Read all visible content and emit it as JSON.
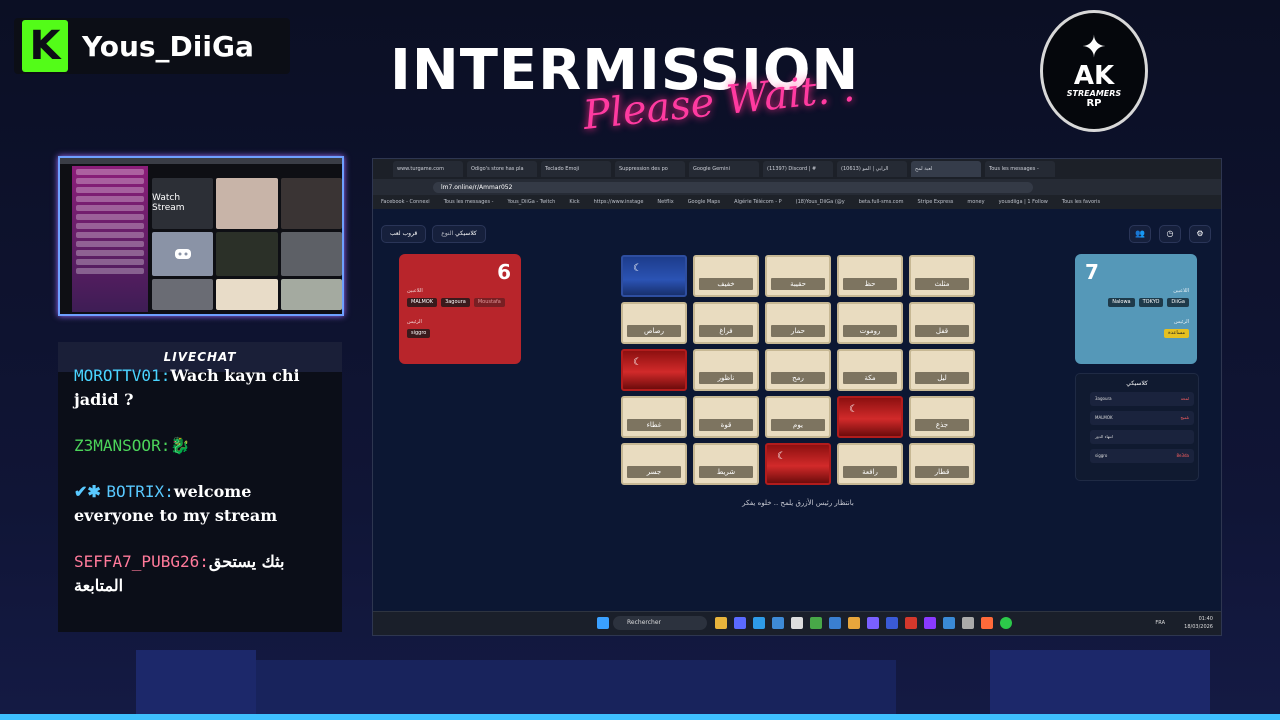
{
  "overlay": {
    "streamer_name": "Yous_DiiGa",
    "kick_letter": "K",
    "title_main": "INTERMISSION",
    "title_sub": "Please Wait. . .",
    "logo": {
      "line1": "AK",
      "line2": "STREAMERS",
      "line3": "RP"
    }
  },
  "webcam": {
    "tile_label": "Watch Stream"
  },
  "livechat": {
    "header": "LIVECHAT",
    "messages": [
      {
        "user": "MOROTTV01:",
        "text": "Wach kayn chi jadid ?",
        "user_color": "#4ad4ff"
      },
      {
        "user": "Z3MANSOOR:",
        "text": "🐉",
        "user_color": "#4cd45a"
      },
      {
        "user": "BOTRIX:",
        "text": "welcome everyone to my stream",
        "user_color": "#59c9ff"
      },
      {
        "user": "SEFFA7_PUBG26:",
        "text": "بثك يستحق المتابعة",
        "user_color": "#ff7a9a"
      }
    ]
  },
  "browser": {
    "tabs": [
      "www.turgame.com",
      "Odigo's store has pla",
      "Teclado Emoji",
      "Suppression des po",
      "Google Gemini",
      "(11397) Discord | #",
      "(10613) الرابي | المو",
      "لعبة لمح",
      "Tous les messages -"
    ],
    "url": "lm7.online/r/Ammar052",
    "bookmarks": [
      "Facebook - Connexi",
      "Tous les messages -",
      "Yous_DiiGa - Twitch",
      "Kick",
      "https://www.instage",
      "Netflix",
      "Google Maps",
      "Algérie Télécom - P",
      "(18)Yous_DiiGa (@y",
      "beta.full-sms.com",
      "Stripe Express",
      "money",
      "yousdiiga | 1 Follow",
      "Tous les favoris"
    ]
  },
  "game": {
    "group_button": "قروب لعب",
    "mode_label": "النوع",
    "mode_value": "كلاسيكي",
    "red_team": {
      "score": "6",
      "members_label": "اللاعبين",
      "members": [
        "MALMOK",
        "3agoura",
        "Moustafa"
      ],
      "leader_label": "الرئيس",
      "leader": [
        "siggro"
      ],
      "color": "#b8252b"
    },
    "blue_team": {
      "score": "7",
      "members_label": "اللاعبين",
      "members": [
        "Nalowa",
        "TOKYO",
        "DiiGa"
      ],
      "leader_label": "الرئيس",
      "leader": [
        "مساعدة"
      ],
      "color": "#5598b8"
    },
    "cards": [
      {
        "word": "",
        "state": "blue"
      },
      {
        "word": "خفيف",
        "state": "hidden"
      },
      {
        "word": "حقيبة",
        "state": "hidden"
      },
      {
        "word": "حظ",
        "state": "hidden"
      },
      {
        "word": "مثلث",
        "state": "hidden"
      },
      {
        "word": "رصاص",
        "state": "hidden"
      },
      {
        "word": "فراغ",
        "state": "hidden"
      },
      {
        "word": "حمار",
        "state": "hidden"
      },
      {
        "word": "روموت",
        "state": "hidden"
      },
      {
        "word": "قفل",
        "state": "hidden"
      },
      {
        "word": "",
        "state": "red"
      },
      {
        "word": "ناظور",
        "state": "hidden"
      },
      {
        "word": "رمح",
        "state": "hidden"
      },
      {
        "word": "مكة",
        "state": "hidden"
      },
      {
        "word": "ليل",
        "state": "hidden"
      },
      {
        "word": "غطاء",
        "state": "hidden"
      },
      {
        "word": "قوة",
        "state": "hidden"
      },
      {
        "word": "يوم",
        "state": "hidden"
      },
      {
        "word": "",
        "state": "red"
      },
      {
        "word": "جذع",
        "state": "hidden"
      },
      {
        "word": "جسر",
        "state": "hidden"
      },
      {
        "word": "شريط",
        "state": "hidden"
      },
      {
        "word": "",
        "state": "red"
      },
      {
        "word": "رافعة",
        "state": "hidden"
      },
      {
        "word": "قطار",
        "state": "hidden"
      }
    ],
    "status": "بانتظار رئيس الأزرق يلمح .. خلوه يفكر",
    "chat": {
      "title": "كلاسيكي",
      "rows": [
        {
          "left": "3agoura",
          "right": "لمحة"
        },
        {
          "left": "MALMOK",
          "right": "تلميح"
        },
        {
          "left": "انتهاء الدور",
          "right": ""
        },
        {
          "left": "siggro",
          "right": "8e3da"
        }
      ]
    }
  },
  "taskbar": {
    "search_placeholder": "Rechercher",
    "lang": "FRA",
    "time": "01:40",
    "date": "18/03/2026"
  }
}
